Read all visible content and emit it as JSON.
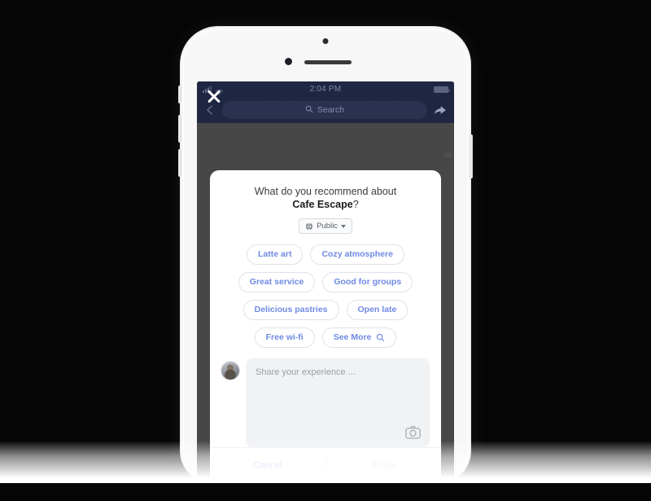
{
  "status_bar": {
    "time": "2:04 PM",
    "signal_icon": "signal-bars-icon",
    "wifi_icon": "wifi-icon",
    "battery_icon": "battery-icon"
  },
  "nav": {
    "close_icon": "close-icon",
    "back_icon": "back-chevron-icon",
    "search_placeholder": "Search",
    "search_icon": "search-icon",
    "share_icon": "share-arrow-icon"
  },
  "backdrop": {
    "ghost_text": "nt"
  },
  "composer": {
    "title_prefix": "What do you recommend about",
    "place_name": "Cafe Escape",
    "title_suffix": "?",
    "privacy": {
      "label": "Public",
      "globe_icon": "globe-icon",
      "chevron_icon": "chevron-down-icon"
    },
    "tag_rows": [
      [
        {
          "label": "Latte art"
        },
        {
          "label": "Cozy atmosphere"
        }
      ],
      [
        {
          "label": "Great service"
        },
        {
          "label": "Good for groups"
        }
      ],
      [
        {
          "label": "Delicious pastries"
        },
        {
          "label": "Open late"
        }
      ],
      [
        {
          "label": "Free wi-fi"
        },
        {
          "label": "See More",
          "icon": "search-icon"
        }
      ]
    ],
    "avatar": "user-avatar",
    "input_placeholder": "Share your experience ...",
    "camera_icon": "camera-icon",
    "cancel_label": "Cancel",
    "share_label": "Share"
  },
  "colors": {
    "fb_header": "#1d2541",
    "pill_text": "#6f8ae4",
    "cancel_text": "#9db4ef",
    "share_text_disabled": "#d8dade",
    "card_background": "#ffffff",
    "backdrop": "#474747",
    "page_background": "#050505"
  }
}
